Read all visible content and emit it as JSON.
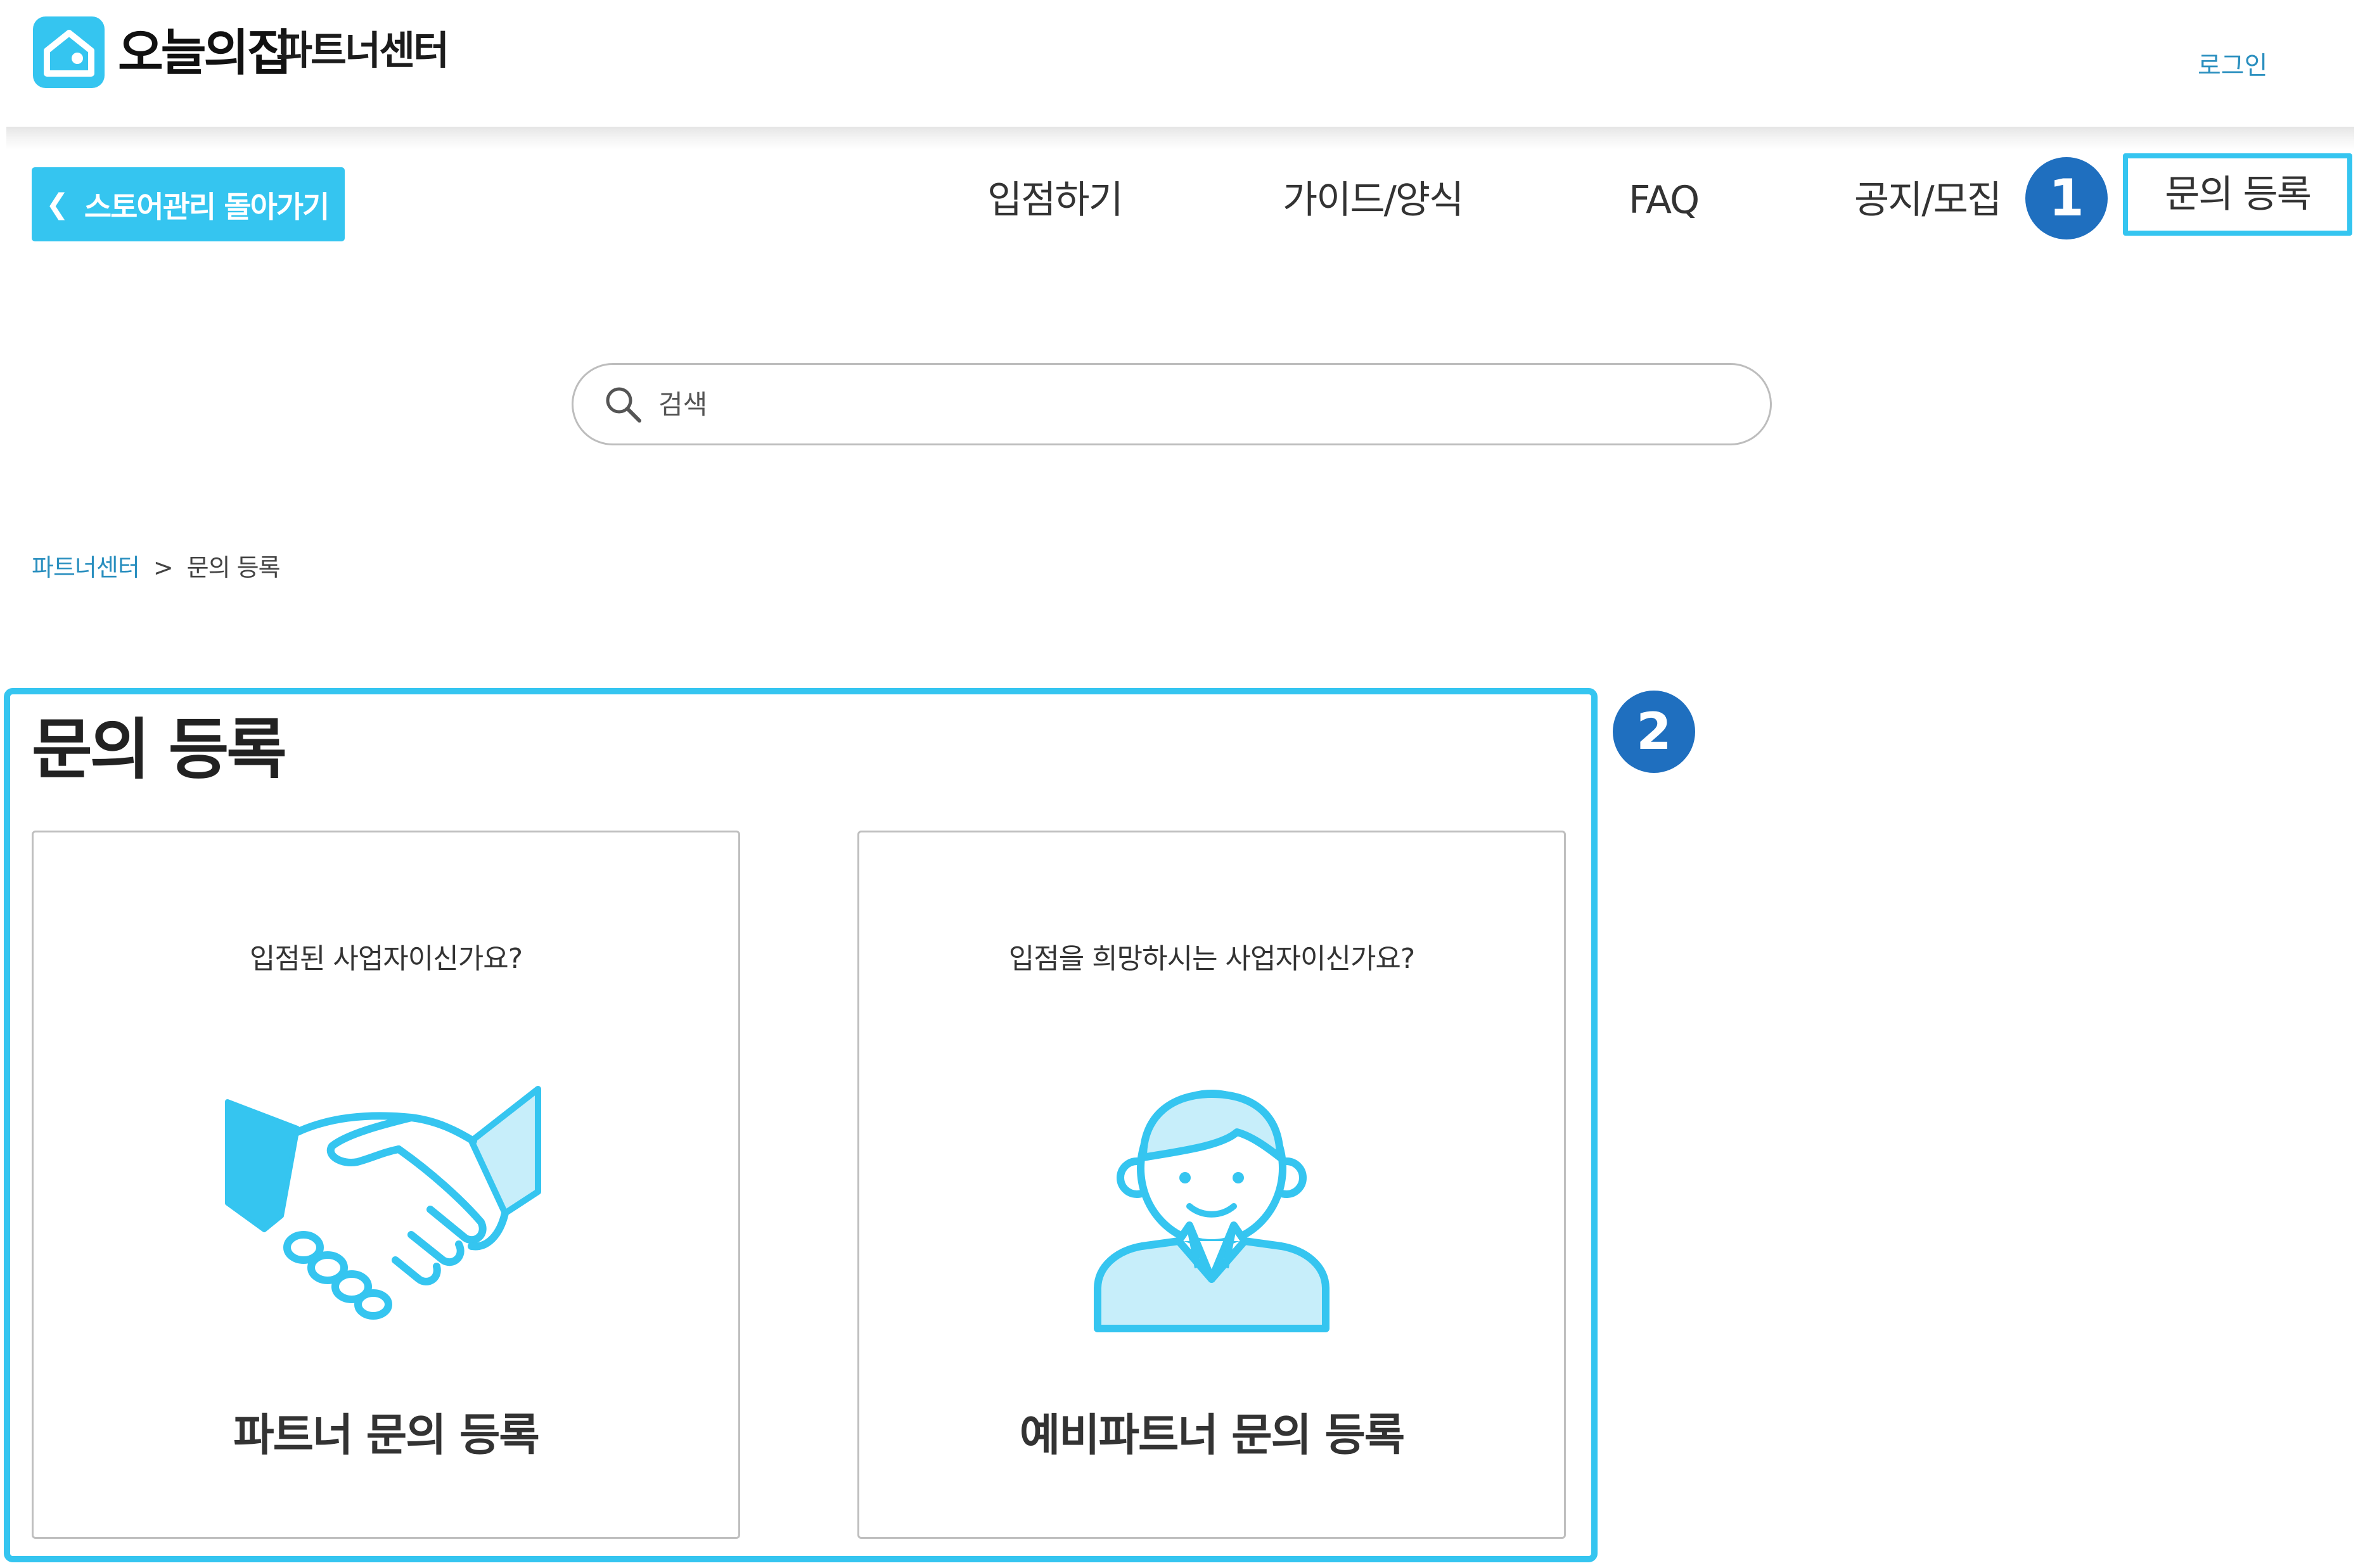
{
  "header": {
    "brand": "오늘의집",
    "subtitle": "파트너센터",
    "login_label": "로그인"
  },
  "back_button": {
    "label": "스토어관리 돌아가기",
    "icon": "chevron-left-icon"
  },
  "nav": {
    "items": [
      {
        "label": "입점하기"
      },
      {
        "label": "가이드/양식"
      },
      {
        "label": "FAQ"
      },
      {
        "label": "공지/모집"
      },
      {
        "label": "문의 등록"
      }
    ]
  },
  "annotations": {
    "step1": "1",
    "step2": "2"
  },
  "search": {
    "placeholder": "검색",
    "value": ""
  },
  "breadcrumb": {
    "root": "파트너센터",
    "separator": ">",
    "current": "문의 등록"
  },
  "page": {
    "title": "문의 등록",
    "cards": [
      {
        "question": "입점된 사업자이신가요?",
        "label": "파트너 문의 등록",
        "icon": "handshake-icon"
      },
      {
        "question": "입점을 희망하시는 사업자이신가요?",
        "label": "예비파트너 문의 등록",
        "icon": "person-icon"
      }
    ]
  },
  "colors": {
    "accent": "#35c5f0",
    "step_badge": "#1f6fbf",
    "link": "#2a8fbf"
  }
}
